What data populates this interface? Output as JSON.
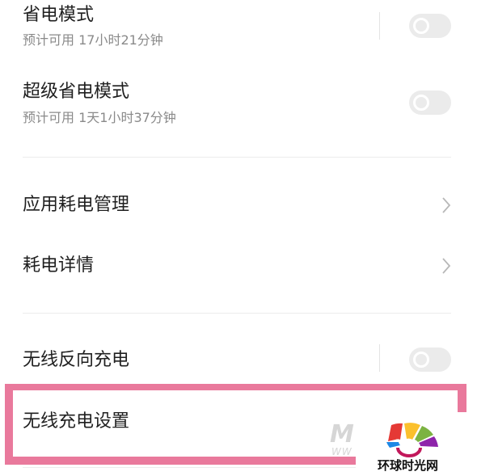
{
  "settings": {
    "power_saving": {
      "title": "省电模式",
      "subtitle": "预计可用 17小时21分钟",
      "enabled": false
    },
    "ultra_power_saving": {
      "title": "超级省电模式",
      "subtitle": "预计可用 1天1小时37分钟",
      "enabled": false
    },
    "app_battery_management": {
      "title": "应用耗电管理"
    },
    "battery_usage_details": {
      "title": "耗电详情"
    },
    "reverse_wireless_charging": {
      "title": "无线反向充电",
      "enabled": false
    },
    "wireless_charging_settings": {
      "title": "无线充电设置"
    }
  },
  "watermark": {
    "logo_text": "环球时光网"
  },
  "colors": {
    "highlight_frame": "#e9799c",
    "toggle_off": "#ebebeb",
    "subtitle_text": "#8a8a8a",
    "divider": "#ececec"
  }
}
